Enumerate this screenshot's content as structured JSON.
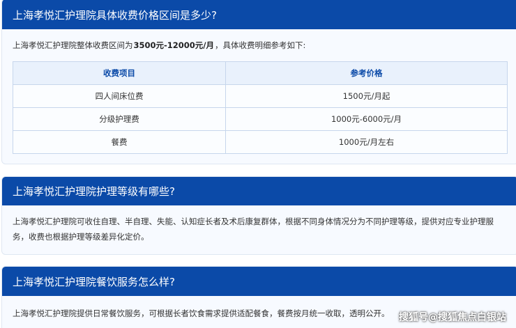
{
  "section1": {
    "title": "上海孝悦汇护理院具体收费价格区间是多少?",
    "intro_prefix": "上海孝悦汇护理院整体收费区间为",
    "intro_bold": "3500元-12000元/月",
    "intro_suffix": "，具体收费明细参考如下:",
    "table": {
      "headers": [
        "收费项目",
        "参考价格"
      ],
      "rows": [
        [
          "四人间床位费",
          "1500元/月起"
        ],
        [
          "分级护理费",
          "1000元-6000元/月"
        ],
        [
          "餐费",
          "1000元/月左右"
        ]
      ]
    }
  },
  "section2": {
    "title": "上海孝悦汇护理院护理等级有哪些?",
    "text": "上海孝悦汇护理院可收住自理、半自理、失能、认知症长者及术后康复群体，根据不同身体情况分为不同护理等级，提供对应专业护理服务，收费也根据护理等级差异化定价。"
  },
  "section3": {
    "title": "上海孝悦汇护理院餐饮服务怎么样?",
    "text": "上海孝悦汇护理院提供日常餐饮服务，可根据长者饮食需求提供适配餐食，餐费按月统一收取，透明公开。"
  },
  "watermark": "搜狐号@搜狐焦点白银站"
}
